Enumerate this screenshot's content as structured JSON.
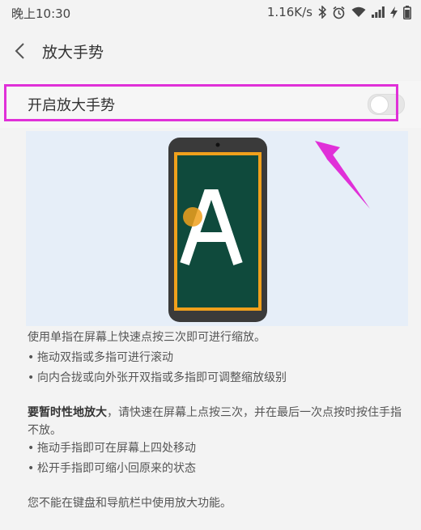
{
  "status_bar": {
    "time": "晚上10:30",
    "network_speed": "1.16K/s",
    "icons": [
      "bluetooth-icon",
      "alarm-icon",
      "wifi-icon",
      "signal-icon",
      "charging-icon",
      "battery-icon"
    ]
  },
  "header": {
    "title": "放大手势"
  },
  "toggle": {
    "label": "开启放大手势",
    "enabled": false
  },
  "illustration": {
    "letter": "A"
  },
  "description": {
    "intro": "使用单指在屏幕上快速点按三次即可进行缩放。",
    "bullets_1": [
      "拖动双指或多指可进行滚动",
      "向内合拢或向外张开双指或多指即可调整缩放级别"
    ],
    "temp_bold": "要暂时性地放大",
    "temp_text": "，请快速在屏幕上点按三次，并在最后一次点按时按住手指不放。",
    "bullets_2": [
      "拖动手指即可在屏幕上四处移动",
      "松开手指即可缩小回原来的状态"
    ],
    "note": "您不能在键盘和导航栏中使用放大功能。"
  },
  "colors": {
    "highlight": "#e030d8",
    "phone_screen": "#0f4a3c",
    "screen_border": "#f0a01c",
    "illustration_bg": "#e6eef8"
  }
}
